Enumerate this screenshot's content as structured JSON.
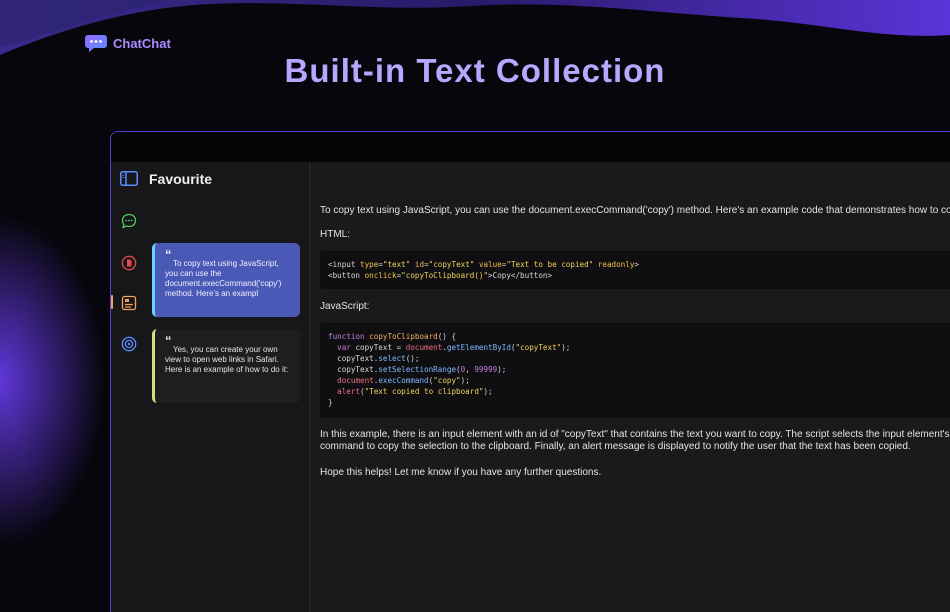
{
  "brand": {
    "name": "ChatChat"
  },
  "hero": {
    "title": "Built-in Text Collection"
  },
  "sidebar": {
    "title": "Favourite",
    "rail_icons": [
      "chat-bubble-icon",
      "document-icon",
      "note-icon",
      "target-icon"
    ],
    "cards": [
      {
        "quote": "“",
        "text": "To copy text using JavaScript, you can use the document.execCommand('copy') method. Here's an exampl",
        "accent": "#6bd0ff"
      },
      {
        "quote": "“",
        "text": "Yes, you can create your own view to open web links in Safari. Here is an example of how to do it:",
        "accent": "#d8e07a"
      }
    ]
  },
  "content": {
    "intro": "To copy text using JavaScript, you can use the document.execCommand('copy') method. Here's an example code that demonstrates how to copy te",
    "html_label": "HTML:",
    "html_code": [
      "<input type=\"text\" id=\"copyText\" value=\"Text to be copied\" readonly>",
      "<button onclick=\"copyToClipboard()\">Copy</button>"
    ],
    "js_label": "JavaScript:",
    "js_code": [
      "function copyToClipboard() {",
      "  var copyText = document.getElementById(\"copyText\");",
      "  copyText.select();",
      "  copyText.setSelectionRange(0, 99999);",
      "  document.execCommand(\"copy\");",
      "  alert(\"Text copied to clipboard\");",
      "}"
    ],
    "explanation": "In this example, there is an input element with an id of \"copyText\" that contains the text you want to copy. The script selects the input element's text command to copy the selection to the clipboard. Finally, an alert message is displayed to notify the user that the text has been copied.",
    "closing": "Hope this helps! Let me know if you have any further questions."
  },
  "colors": {
    "accent": "#6a3df0",
    "title": "#b9a6ff",
    "card_active": "#4a58b6"
  }
}
